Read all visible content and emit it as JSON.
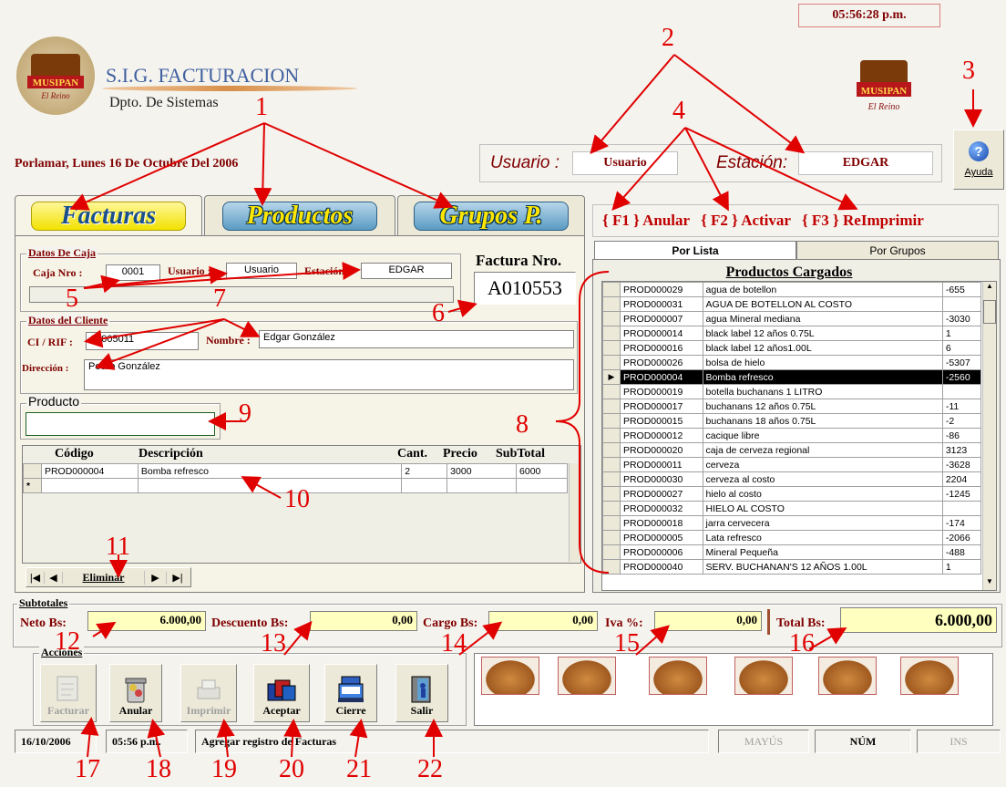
{
  "clock": "05:56:28 p.m.",
  "app": {
    "title": "S.I.G. FACTURACION",
    "subtitle": "Dpto. De Sistemas",
    "logo_text": "MUSIPAN El Reino"
  },
  "date_line": "Porlamar, Lunes 16 De Octubre Del 2006",
  "session": {
    "user_label": "Usuario :",
    "user_value": "Usuario",
    "station_label": "Estación:",
    "station_value": "EDGAR"
  },
  "help_label": "Ayuda",
  "tabs": [
    "Facturas",
    "Productos",
    "Grupos P."
  ],
  "function_keys": [
    {
      "key": "{ F1 }",
      "label": "Anular"
    },
    {
      "key": "{ F2 }",
      "label": "Activar"
    },
    {
      "key": "{ F3 }",
      "label": "ReImprimir"
    }
  ],
  "caja": {
    "legend": "Datos De Caja",
    "caja_label": "Caja Nro :",
    "caja_value": "0001",
    "usuario_label": "Usuario :",
    "usuario_value": "Usuario",
    "estacion_label": "Estación :",
    "estacion_value": "EDGAR"
  },
  "factura": {
    "label": "Factura Nro.",
    "number": "A010553"
  },
  "cliente": {
    "legend": "Datos del Cliente",
    "ci_label": "CI / RIF :",
    "ci_value": "15005011",
    "nombre_label": "Nombre :",
    "nombre_value": "Edgar González",
    "direccion_label": "Dirección :",
    "direccion_value": "Pedro González"
  },
  "producto_legend": "Producto",
  "invoice_grid": {
    "headers": [
      "Código",
      "Descripción",
      "Cant.",
      "Precio",
      "SubTotal"
    ],
    "rows": [
      [
        "PROD000004",
        "Bomba refresco",
        "2",
        "3000",
        "6000"
      ]
    ],
    "new_row_marker": "*"
  },
  "nav": {
    "first": "|◀",
    "prev": "◀",
    "delete": "Eliminar",
    "next": "▶",
    "last": "▶|"
  },
  "list_tabs": [
    "Por Lista",
    "Por Grupos"
  ],
  "products": {
    "title": "Productos Cargados",
    "rows": [
      [
        "PROD000029",
        "agua de botellon",
        "-655"
      ],
      [
        "PROD000031",
        "AGUA DE BOTELLON AL COSTO",
        ""
      ],
      [
        "PROD000007",
        "agua Mineral mediana",
        "-3030"
      ],
      [
        "PROD000014",
        "black label 12 años 0.75L",
        "1"
      ],
      [
        "PROD000016",
        "black label 12 años1.00L",
        "6"
      ],
      [
        "PROD000026",
        "bolsa de hielo",
        "-5307"
      ],
      [
        "PROD000004",
        "Bomba refresco",
        "-2560"
      ],
      [
        "PROD000019",
        "botella buchanans 1 LITRO",
        ""
      ],
      [
        "PROD000017",
        "buchanans 12 años 0.75L",
        "-11"
      ],
      [
        "PROD000015",
        "buchanans 18 años 0.75L",
        "-2"
      ],
      [
        "PROD000012",
        "cacique libre",
        "-86"
      ],
      [
        "PROD000020",
        "caja de cerveza regional",
        "3123"
      ],
      [
        "PROD000011",
        "cerveza",
        "-3628"
      ],
      [
        "PROD000030",
        "cerveza al costo",
        "2204"
      ],
      [
        "PROD000027",
        "hielo al costo",
        "-1245"
      ],
      [
        "PROD000032",
        "HIELO AL COSTO",
        ""
      ],
      [
        "PROD000018",
        "jarra cervecera",
        "-174"
      ],
      [
        "PROD000005",
        "Lata refresco",
        "-2066"
      ],
      [
        "PROD000006",
        "Mineral Pequeña",
        "-488"
      ],
      [
        "PROD000040",
        "SERV. BUCHANAN'S 12 AÑOS 1.00L",
        "1"
      ]
    ],
    "selected_index": 6
  },
  "subtotales": {
    "legend": "Subtotales",
    "neto_label": "Neto Bs:",
    "neto_value": "6.000,00",
    "descuento_label": "Descuento Bs:",
    "descuento_value": "0,00",
    "cargo_label": "Cargo Bs:",
    "cargo_value": "0,00",
    "iva_label": "Iva %:",
    "iva_value": "0,00",
    "total_label": "Total Bs:",
    "total_value": "6.000,00"
  },
  "acciones": {
    "legend": "Acciones",
    "buttons": [
      "Facturar",
      "Anular",
      "Imprimir",
      "Aceptar",
      "Cierre",
      "Salir"
    ]
  },
  "status": {
    "date": "16/10/2006",
    "time": "05:56 p.m.",
    "message": "Agregar registro de Facturas",
    "caps": "MAYÚS",
    "num": "NÚM",
    "ins": "INS"
  },
  "annotations": [
    "1",
    "2",
    "3",
    "4",
    "5",
    "6",
    "7",
    "8",
    "9",
    "10",
    "11",
    "12",
    "13",
    "14",
    "15",
    "16",
    "17",
    "18",
    "19",
    "20",
    "21",
    "22"
  ],
  "colors": {
    "label": "#800000",
    "annotation": "#e00000",
    "input_yellow": "#ffffc0",
    "tab_yellow": "#f2e200"
  }
}
